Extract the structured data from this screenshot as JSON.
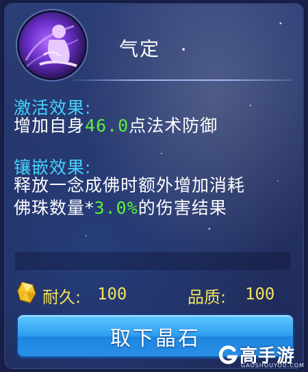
{
  "item": {
    "name": "气定",
    "icon": "meditating-monk-silhouette-icon"
  },
  "effects": {
    "activate_label": "激活效果:",
    "activate_prefix": "增加自身",
    "activate_value": "46.0",
    "activate_suffix": "点法术防御",
    "inlay_label": "镶嵌效果:",
    "inlay_line1": "释放一念成佛时额外增加消耗",
    "inlay_line2_prefix": "佛珠数量*",
    "inlay_value": "3.0%",
    "inlay_line2_suffix": "的伤害结果"
  },
  "stats": {
    "durability_icon": "yellow-crystal-icon",
    "durability_label": "耐久:",
    "durability_value": "100",
    "quality_label": "品质:",
    "quality_value": "100"
  },
  "actions": {
    "remove_label": "取下晶石"
  },
  "watermark": {
    "main": "高手游",
    "sub": "GAOSHOUYOU.COM"
  },
  "colors": {
    "label": "#46d2ff",
    "highlight": "#5df23a",
    "stat": "#f2e35a",
    "button": "#2f9ef0"
  }
}
